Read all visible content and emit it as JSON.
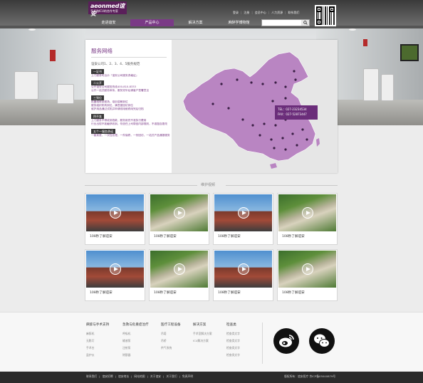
{
  "header": {
    "brand": "aeonmed谊安",
    "tagline": "手术和ICU的合作专家",
    "top_links": [
      "登录",
      "注册",
      "会员中心",
      "人力资源",
      "联系我们"
    ],
    "nav": [
      {
        "label": "走进谊安",
        "active": false
      },
      {
        "label": "产品中心",
        "active": true
      },
      {
        "label": "解决方案",
        "active": false
      },
      {
        "label": "麻醉学博物馆",
        "active": false
      }
    ],
    "search_placeholder": "",
    "accent": "#7a3a86"
  },
  "service": {
    "title": "服务网络",
    "subtitle": "谊安公司1、2、3、4、5服务规范",
    "tiers": [
      {
        "badge": "一证书",
        "lines": [
          "上门服务时出示『谊安公司服务资格证』"
        ]
      },
      {
        "badge": "二公开",
        "lines": [
          "公开谊安公司服务热线400-810-8333",
          "公开一站式服务体系，服务完毕后请客户签署意见"
        ]
      },
      {
        "badge": "三到位",
        "lines": [
          "机器维修到现场，培训讲解到位",
          "服务组织机构到位，满意度回访到位",
          "维护用品通过试机并申请领用维修用完后归档"
        ]
      },
      {
        "badge": "四不准",
        "lines": [
          "上门服务不得收到钱款，服务用完不准执行费用",
          "行业出现不准截获收到，勿信任上司带回内部规则，不准擅自更改"
        ]
      },
      {
        "badge": "五个一服务承诺",
        "lines": [
          "一套到底，一次性处理，一件保修，一份回访，一站式产品通报服务"
        ]
      }
    ],
    "phone": "TEL：027-23234534",
    "fax": "FAX：027-52873447"
  },
  "videos": {
    "section_title": "维护视频",
    "items": [
      {
        "caption": "108秒了解谊安",
        "thumb": "building"
      },
      {
        "caption": "108秒了解谊安",
        "thumb": "campus"
      },
      {
        "caption": "108秒了解谊安",
        "thumb": "building"
      },
      {
        "caption": "108秒了解谊安",
        "thumb": "campus"
      },
      {
        "caption": "108秒了解谊安",
        "thumb": "building"
      },
      {
        "caption": "108秒了解谊安",
        "thumb": "campus"
      },
      {
        "caption": "108秒了解谊安",
        "thumb": "building"
      },
      {
        "caption": "108秒了解谊安",
        "thumb": "campus"
      }
    ]
  },
  "footer": {
    "columns": [
      {
        "title": "麻醉与手术支持",
        "links": [
          "麻醉机",
          "无影灯",
          "手术台",
          "监护仪"
        ]
      },
      {
        "title": "急救与危重症治疗",
        "links": [
          "呼吸机",
          "输液泵",
          "注射泵",
          "除颤器"
        ]
      },
      {
        "title": "医疗工程设备",
        "links": [
          "吊塔",
          "吊桥",
          "供气系统"
        ]
      },
      {
        "title": "解决方案",
        "links": [
          "手术室解决方案",
          "ICU解决方案"
        ]
      },
      {
        "title": "检查类",
        "links": [
          "检查类文字",
          "检查类文字",
          "检查类文字",
          "检查类文字"
        ]
      }
    ],
    "social": [
      "weibo-icon",
      "wechat-icon"
    ],
    "bottom_links": [
      "联系我们",
      "谊安招聘",
      "谊安地址",
      "网站地图",
      "关于谊安",
      "关于我们",
      "免责声明"
    ],
    "copyright": "版权所有：谊安医疗 京ICP备05040879号"
  }
}
